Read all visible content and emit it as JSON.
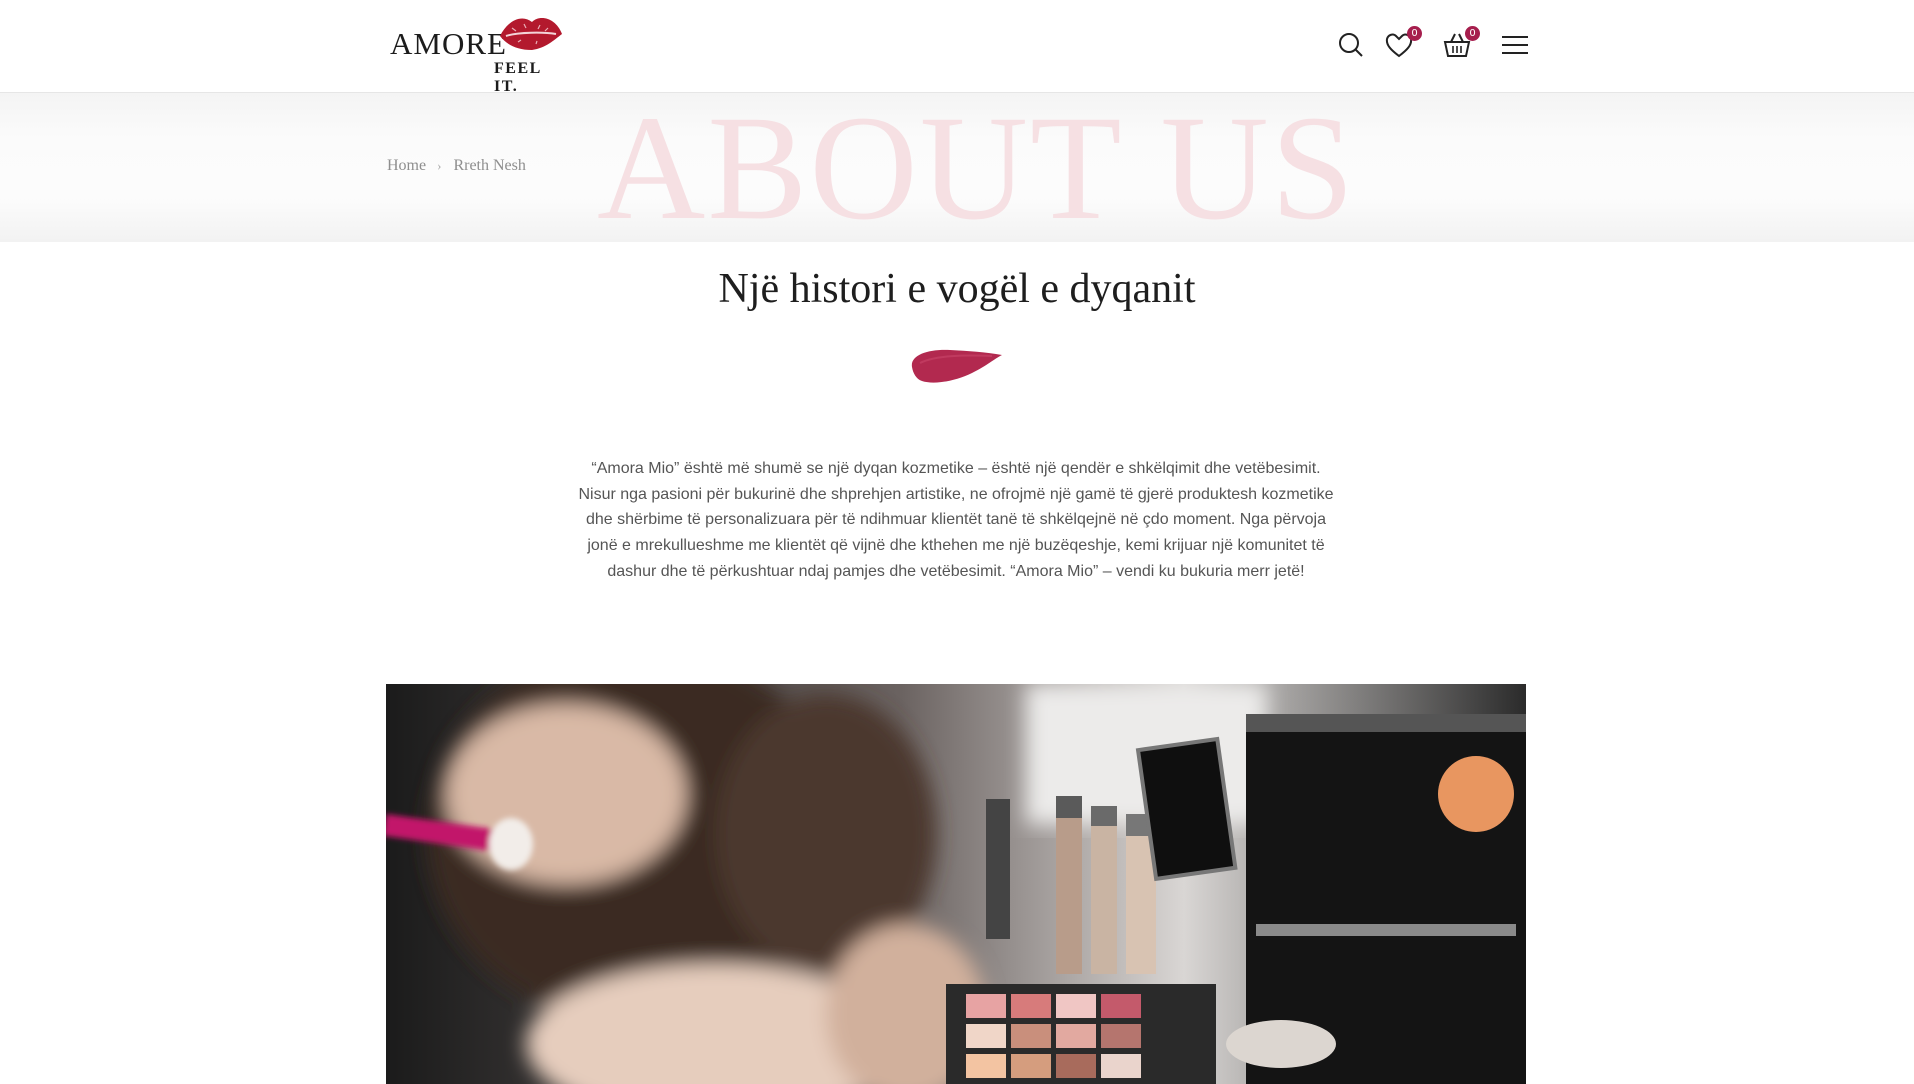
{
  "brand": {
    "name": "AMORE",
    "tagline": "FEEL IT."
  },
  "header": {
    "icons": [
      {
        "name": "search-icon"
      },
      {
        "name": "heart-icon",
        "badge": "0"
      },
      {
        "name": "basket-icon",
        "badge": "0"
      },
      {
        "name": "menu-icon"
      }
    ]
  },
  "hero": {
    "background_text": "ABOUT US",
    "breadcrumb": {
      "home": "Home",
      "current": "Rreth Nesh"
    }
  },
  "main": {
    "title": "Një histori e vogël e dyqanit",
    "intro": "“Amora Mio” është më shumë se një dyqan kozmetike – është një qendër e shkëlqimit dhe vetëbesimit. Nisur nga pasioni për bukurinë dhe shprehjen artistike, ne ofrojmë një gamë të gjerë produktesh kozmetike dhe shërbime të personalizuara për të ndihmuar klientët tanë të shkëlqejnë në çdo moment. Nga përvoja jonë e mrekullueshme me klientët që vijnë dhe kthehen me një buzëqeshje, kemi krijuar një komunitet të dashur dhe të përkushtuar ndaj pamjes dhe vetëbesimit. “Amora Mio” – vendi ku bukuria merr jetë!"
  },
  "colors": {
    "accent": "#a61e4d",
    "watermark": "#f6e0e3"
  }
}
